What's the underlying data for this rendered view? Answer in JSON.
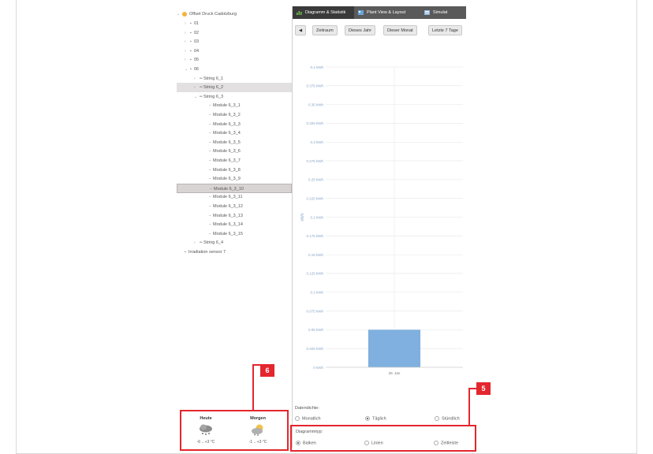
{
  "tree": {
    "root": "Offset Druck Cadolzburg",
    "items": [
      {
        "label": "01",
        "level": 1,
        "arrow": "›",
        "glyph": "▪"
      },
      {
        "label": "02",
        "level": 1,
        "arrow": "›",
        "glyph": "▪"
      },
      {
        "label": "03",
        "level": 1,
        "arrow": "›",
        "glyph": "▪"
      },
      {
        "label": "04",
        "level": 1,
        "arrow": "›",
        "glyph": "▪"
      },
      {
        "label": "05",
        "level": 1,
        "arrow": "›",
        "glyph": "▪"
      },
      {
        "label": "06",
        "level": 1,
        "arrow": "⌄",
        "glyph": "▪"
      },
      {
        "label": "String 6_1",
        "level": 2,
        "arrow": "›",
        "glyph": "═"
      },
      {
        "label": "String 6_2",
        "level": 2,
        "arrow": "›",
        "glyph": "═",
        "sel": true
      },
      {
        "label": "String 6_3",
        "level": 2,
        "arrow": "⌄",
        "glyph": "═"
      },
      {
        "label": "Module 6_3_1",
        "level": 3,
        "glyph": "−"
      },
      {
        "label": "Module 6_3_2",
        "level": 3,
        "glyph": "−"
      },
      {
        "label": "Module 6_3_3",
        "level": 3,
        "glyph": "−"
      },
      {
        "label": "Module 6_3_4",
        "level": 3,
        "glyph": "−"
      },
      {
        "label": "Module 6_3_5",
        "level": 3,
        "glyph": "−"
      },
      {
        "label": "Module 6_3_6",
        "level": 3,
        "glyph": "−"
      },
      {
        "label": "Module 6_3_7",
        "level": 3,
        "glyph": "−"
      },
      {
        "label": "Module 6_3_8",
        "level": 3,
        "glyph": "−"
      },
      {
        "label": "Module 6_3_9",
        "level": 3,
        "glyph": "−"
      },
      {
        "label": "Module 6_3_10",
        "level": 3,
        "glyph": "−",
        "selStrong": true
      },
      {
        "label": "Module 6_3_11",
        "level": 3,
        "glyph": "−"
      },
      {
        "label": "Module 6_3_12",
        "level": 3,
        "glyph": "−"
      },
      {
        "label": "Module 6_3_13",
        "level": 3,
        "glyph": "−"
      },
      {
        "label": "Module 6_3_14",
        "level": 3,
        "glyph": "−"
      },
      {
        "label": "Module 6_3_15",
        "level": 3,
        "glyph": "−"
      },
      {
        "label": "String 6_4",
        "level": 2,
        "arrow": "›",
        "glyph": "═"
      },
      {
        "label": "Irradiation sensor 7",
        "level": 1,
        "glyph": "▪"
      }
    ]
  },
  "tabs": [
    {
      "label": "Diagramm & Statistik",
      "active": true,
      "icon": "bar-chart-icon",
      "color": "#6fc24f"
    },
    {
      "label": "Plant View & Layout",
      "active": false,
      "icon": "layout-icon",
      "color": "#6aa3d8"
    },
    {
      "label": "Simulat",
      "active": false,
      "icon": "simulation-icon",
      "color": "#8fb8e0"
    }
  ],
  "toolbar": {
    "back_icon": "◀",
    "buttons": [
      "Zeitraum",
      "Dieses Jahr",
      "Dieser Monat",
      "Letzte 7 Tage"
    ]
  },
  "chart_data": {
    "type": "bar",
    "categories": [
      "29. Jan"
    ],
    "values": [
      0.05
    ],
    "ylabel": "kWh",
    "ylim": [
      0,
      0.4
    ],
    "yticks": [
      "0 kWh",
      "0.025 kWh",
      "0.05 kWh",
      "0.075 kWh",
      "0.1 kWh",
      "0.125 kWh",
      "0.15 kWh",
      "0.175 kWh",
      "0.2 kWh",
      "0.225 kWh",
      "0.25 kWh",
      "0.275 kWh",
      "0.3 kWh",
      "0.325 kWh",
      "0.35 kWh",
      "0.375 kWh",
      "0.4 kWh"
    ],
    "grid": true,
    "bar_color": "#7fb0df"
  },
  "datendichte": {
    "label": "Datendichte:",
    "options": [
      {
        "label": "Monatlich",
        "checked": false
      },
      {
        "label": "Täglich",
        "checked": true
      },
      {
        "label": "Stündlich",
        "checked": false
      }
    ]
  },
  "diagrammtyp": {
    "label": "Diagrammtyp:",
    "options": [
      {
        "label": "Balken",
        "checked": true
      },
      {
        "label": "Linien",
        "checked": false
      },
      {
        "label": "Zeitleiste",
        "checked": false
      }
    ]
  },
  "weather": {
    "today": {
      "label": "Heute",
      "temp": "-6 .. +3 °C",
      "icon": "snow-cloud-icon"
    },
    "tomorrow": {
      "label": "Morgen",
      "temp": "-1 .. +3 °C",
      "icon": "sun-cloud-icon"
    }
  },
  "callouts": {
    "weather": "6",
    "diagram_type": "5"
  }
}
